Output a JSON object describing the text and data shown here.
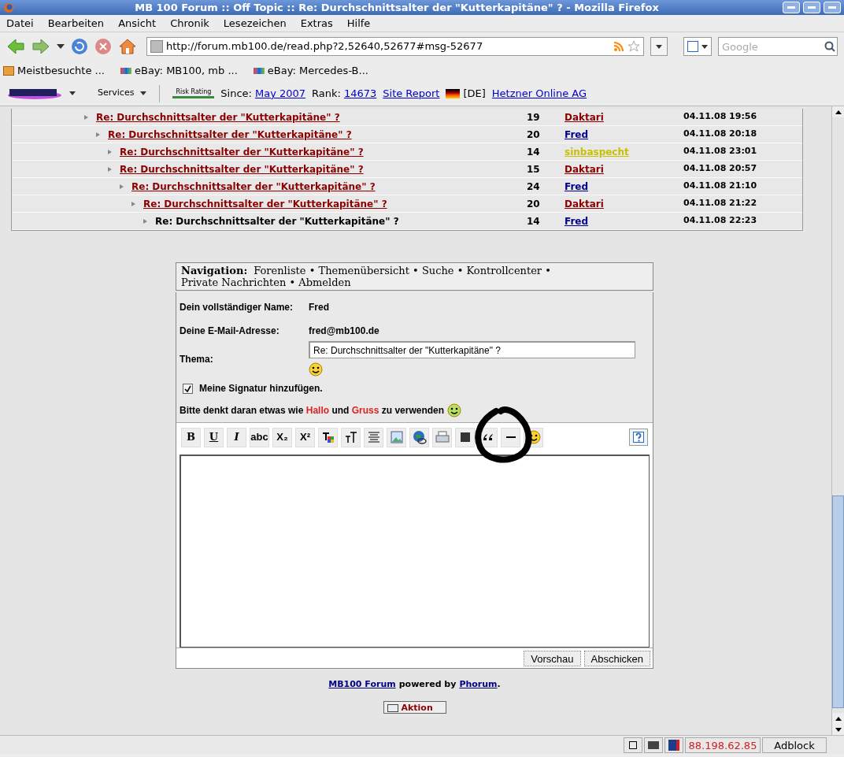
{
  "window": {
    "title": "MB 100 Forum :: Off Topic :: Re: Durchschnittsalter der \"Kutterkapitäne\" ? - Mozilla Firefox"
  },
  "menu": [
    "Datei",
    "Bearbeiten",
    "Ansicht",
    "Chronik",
    "Lesezeichen",
    "Extras",
    "Hilfe"
  ],
  "address_bar": {
    "value": "http://forum.mb100.de/read.php?2,52640,52677#msg-52677"
  },
  "search": {
    "placeholder": "Google"
  },
  "bookmarks": [
    {
      "kind": "folder",
      "label": "Meistbesuchte ..."
    },
    {
      "kind": "ebay",
      "label": "eBay: MB100, mb ..."
    },
    {
      "kind": "ebay",
      "label": "eBay: Mercedes-B..."
    }
  ],
  "netcraft": {
    "services": "Services",
    "risk": "Risk Rating",
    "since_label": "Since:",
    "since": "May 2007",
    "rank_label": "Rank:",
    "rank": "14673",
    "report": "Site Report",
    "country": "[DE]",
    "host": "Hetzner Online AG"
  },
  "thread": [
    {
      "subject": "Re: Durchschnittsalter der \"Kutterkapitäne\" ?",
      "count": "19",
      "author": "Daktari",
      "color": "#8b0000",
      "date": "04.11.08 19:56",
      "selected": false,
      "children": [
        {
          "subject": "Re: Durchschnittsalter der \"Kutterkapitäne\" ?",
          "count": "20",
          "author": "Fred",
          "color": "#00008b",
          "date": "04.11.08 20:18",
          "selected": false,
          "children": [
            {
              "subject": "Re: Durchschnittsalter der \"Kutterkapitäne\" ?",
              "count": "14",
              "author": "sinbaspecht",
              "color": "#c8c000",
              "date": "04.11.08 23:01",
              "selected": false
            },
            {
              "subject": "Re: Durchschnittsalter der \"Kutterkapitäne\" ?",
              "count": "15",
              "author": "Daktari",
              "color": "#8b0000",
              "date": "04.11.08 20:57",
              "selected": false,
              "children": [
                {
                  "subject": "Re: Durchschnittsalter der \"Kutterkapitäne\" ?",
                  "count": "24",
                  "author": "Fred",
                  "color": "#00008b",
                  "date": "04.11.08 21:10",
                  "selected": false,
                  "children": [
                    {
                      "subject": "Re: Durchschnittsalter der \"Kutterkapitäne\" ?",
                      "count": "20",
                      "author": "Daktari",
                      "color": "#8b0000",
                      "date": "04.11.08 21:22",
                      "selected": false,
                      "children": [
                        {
                          "subject": "Re: Durchschnittsalter der \"Kutterkapitäne\" ?",
                          "count": "14",
                          "author": "Fred",
                          "color": "#00008b",
                          "date": "04.11.08 22:23",
                          "selected": true
                        }
                      ]
                    }
                  ]
                }
              ]
            }
          ]
        }
      ]
    }
  ],
  "navigation": {
    "label": "Navigation:",
    "separator": "•",
    "links": [
      "Forenliste",
      "Themenübersicht",
      "Suche",
      "Kontrollcenter",
      "Private Nachrichten",
      "Abmelden"
    ]
  },
  "form": {
    "name_label": "Dein vollständiger Name:",
    "name": "Fred",
    "email_label": "Deine E-Mail-Adresse:",
    "email": "fred@mb100.de",
    "subject_label": "Thema:",
    "subject": "Re: Durchschnittsalter der \"Kutterkapitäne\" ?",
    "signature": {
      "label": "Meine Signatur hinzufügen.",
      "checked": true
    },
    "hint": [
      {
        "kind": "plain",
        "text": "Bitte denkt daran etwas wie "
      },
      {
        "kind": "highlight",
        "text": "Hallo"
      },
      {
        "kind": "plain",
        "text": " und "
      },
      {
        "kind": "highlight",
        "text": "Gruss"
      },
      {
        "kind": "plain",
        "text": " zu verwenden"
      }
    ]
  },
  "editor_toolbar": [
    {
      "kind": "bold",
      "label": "B"
    },
    {
      "kind": "underline",
      "label": "U"
    },
    {
      "kind": "italic",
      "label": "I"
    },
    {
      "kind": "strike",
      "label": "abc"
    },
    {
      "kind": "sub",
      "label": "X₂"
    },
    {
      "kind": "sup",
      "label": "X²"
    },
    {
      "kind": "color"
    },
    {
      "kind": "size"
    },
    {
      "kind": "center"
    },
    {
      "kind": "image"
    },
    {
      "kind": "link"
    },
    {
      "kind": "email"
    },
    {
      "kind": "code"
    },
    {
      "kind": "quote"
    },
    {
      "kind": "hr"
    },
    {
      "kind": "smiley"
    }
  ],
  "buttons": [
    "Vorschau",
    "Abschicken"
  ],
  "footer": {
    "forum": "MB100 Forum",
    "powered": "powered by",
    "phorum": "Phorum",
    "end": ".",
    "action": "Aktion"
  },
  "status_bar": {
    "ip": "88.198.62.85",
    "adblock": "Adblock"
  }
}
